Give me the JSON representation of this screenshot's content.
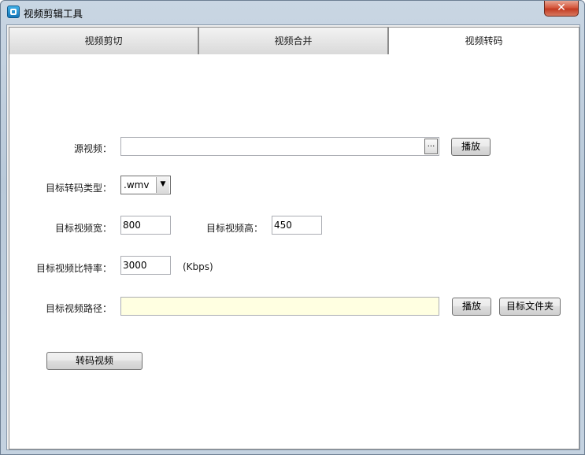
{
  "window": {
    "title": "视频剪辑工具",
    "close_glyph": "✕"
  },
  "tabs": [
    {
      "label": "视频剪切",
      "selected": false
    },
    {
      "label": "视频合并",
      "selected": false
    },
    {
      "label": "视频转码",
      "selected": true
    }
  ],
  "form": {
    "source_label": "源视频：",
    "source_value": "",
    "browse_label": "...",
    "play_source_label": "播放",
    "target_type_label": "目标转码类型：",
    "target_type_value": ".wmv",
    "width_label": "目标视频宽：",
    "width_value": "800",
    "height_label": "目标视频高：",
    "height_value": "450",
    "bitrate_label": "目标视频比特率：",
    "bitrate_value": "3000",
    "bitrate_unit": "(Kbps)",
    "target_path_label": "目标视频路径：",
    "target_path_value": "",
    "play_target_label": "播放",
    "open_folder_label": "目标文件夹",
    "convert_label": "转码视频"
  },
  "colors": {
    "title_bar": "#c9d6e3",
    "close_button": "#c23b22",
    "path_field_bg": "#ffffe1",
    "panel_bg": "#ffffff"
  }
}
